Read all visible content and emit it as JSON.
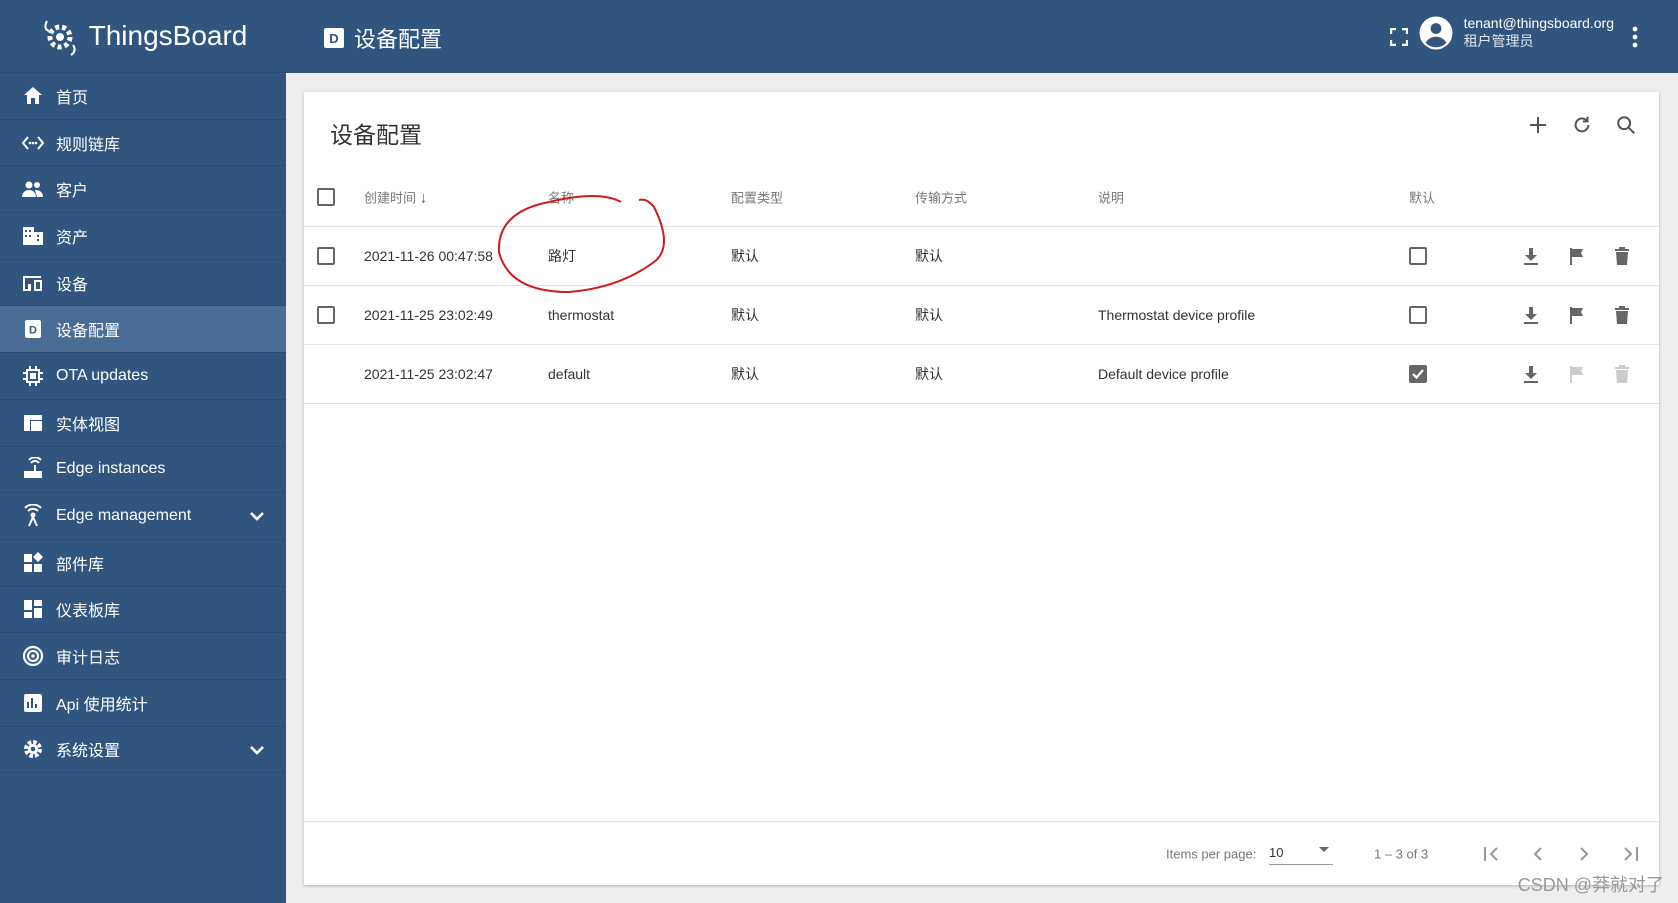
{
  "app": {
    "name": "ThingsBoard"
  },
  "sidebar": {
    "items": [
      {
        "label": "首页",
        "icon": "home-icon"
      },
      {
        "label": "规则链库",
        "icon": "code-icon"
      },
      {
        "label": "客户",
        "icon": "people-icon"
      },
      {
        "label": "资产",
        "icon": "building-icon"
      },
      {
        "label": "设备",
        "icon": "devices-icon"
      },
      {
        "label": "设备配置",
        "icon": "device-profile-icon",
        "active": true
      },
      {
        "label": "OTA updates",
        "icon": "memory-icon"
      },
      {
        "label": "实体视图",
        "icon": "view-icon"
      },
      {
        "label": "Edge instances",
        "icon": "router-icon"
      },
      {
        "label": "Edge management",
        "icon": "antenna-icon",
        "expandable": true
      },
      {
        "label": "部件库",
        "icon": "widgets-icon"
      },
      {
        "label": "仪表板库",
        "icon": "dashboard-icon"
      },
      {
        "label": "审计日志",
        "icon": "track-icon"
      },
      {
        "label": "Api 使用统计",
        "icon": "chart-icon"
      },
      {
        "label": "系统设置",
        "icon": "gear-icon",
        "expandable": true
      }
    ]
  },
  "header": {
    "title": "设备配置",
    "user_email": "tenant@thingsboard.org",
    "user_role": "租户管理员"
  },
  "main": {
    "title": "设备配置",
    "columns": [
      "创建时间",
      "名称",
      "配置类型",
      "传输方式",
      "说明",
      "默认"
    ],
    "rows": [
      {
        "created": "2021-11-26 00:47:58",
        "name": "路灯",
        "type": "默认",
        "transport": "默认",
        "description": "",
        "default": false
      },
      {
        "created": "2021-11-25 23:02:49",
        "name": "thermostat",
        "type": "默认",
        "transport": "默认",
        "description": "Thermostat device profile",
        "default": false
      },
      {
        "created": "2021-11-25 23:02:47",
        "name": "default",
        "type": "默认",
        "transport": "默认",
        "description": "Default device profile",
        "default": true
      }
    ],
    "pagination": {
      "items_per_page_label": "Items per page:",
      "items_per_page": "10",
      "range": "1 – 3 of 3"
    }
  },
  "annotation_color": "#d01c1c",
  "watermark": "CSDN @莽就对了"
}
